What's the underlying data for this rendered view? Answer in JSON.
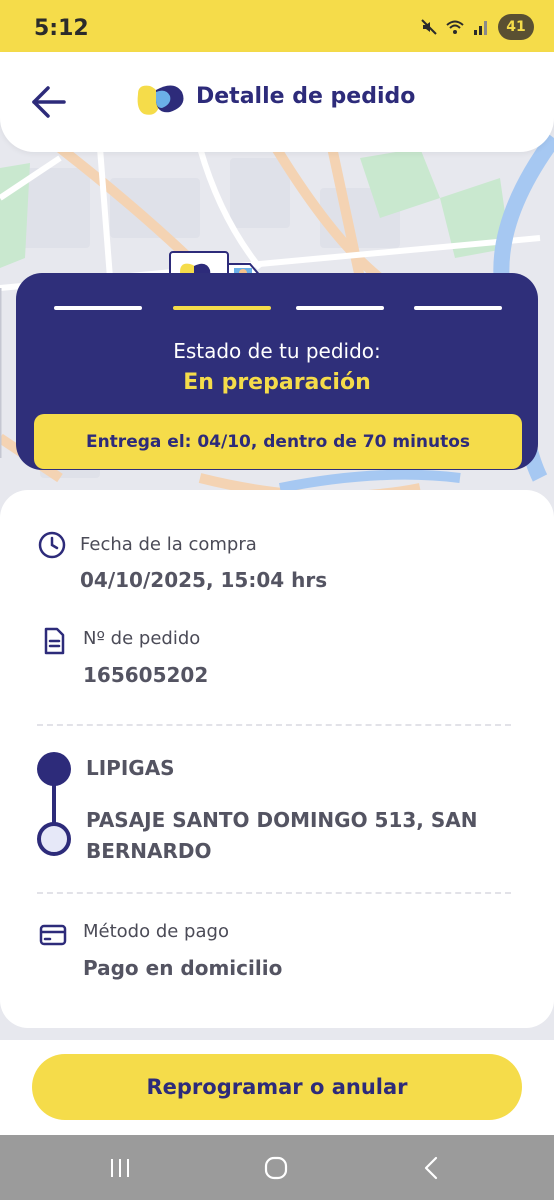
{
  "status_bar": {
    "time": "5:12",
    "battery": "41"
  },
  "header": {
    "title": "Detalle de pedido"
  },
  "order_status": {
    "label": "Estado de tu pedido:",
    "value": "En preparación",
    "delivery": "Entrega el: 04/10, dentro de 70 minutos",
    "progress_step": 2,
    "progress_total": 4
  },
  "details": {
    "purchase_date_label": "Fecha de la compra",
    "purchase_date_value": "04/10/2025, 15:04 hrs",
    "order_number_label": "Nº de pedido",
    "order_number_value": "165605202",
    "route_origin": "LIPIGAS",
    "route_destination_line1": "PASAJE SANTO DOMINGO 513, SAN",
    "route_destination_line2": "BERNARDO",
    "payment_label": "Método de pago",
    "payment_value": "Pago en domicilio"
  },
  "action_button": "Reprogramar o anular",
  "colors": {
    "brand_navy": "#2d2b7a",
    "brand_yellow": "#f5dc4a",
    "card_navy": "#2f2f7a"
  },
  "icons": {
    "back": "arrow-left-icon",
    "logo": "lipigas-logo",
    "clock": "clock-icon",
    "document": "document-icon",
    "card": "credit-card-icon"
  }
}
